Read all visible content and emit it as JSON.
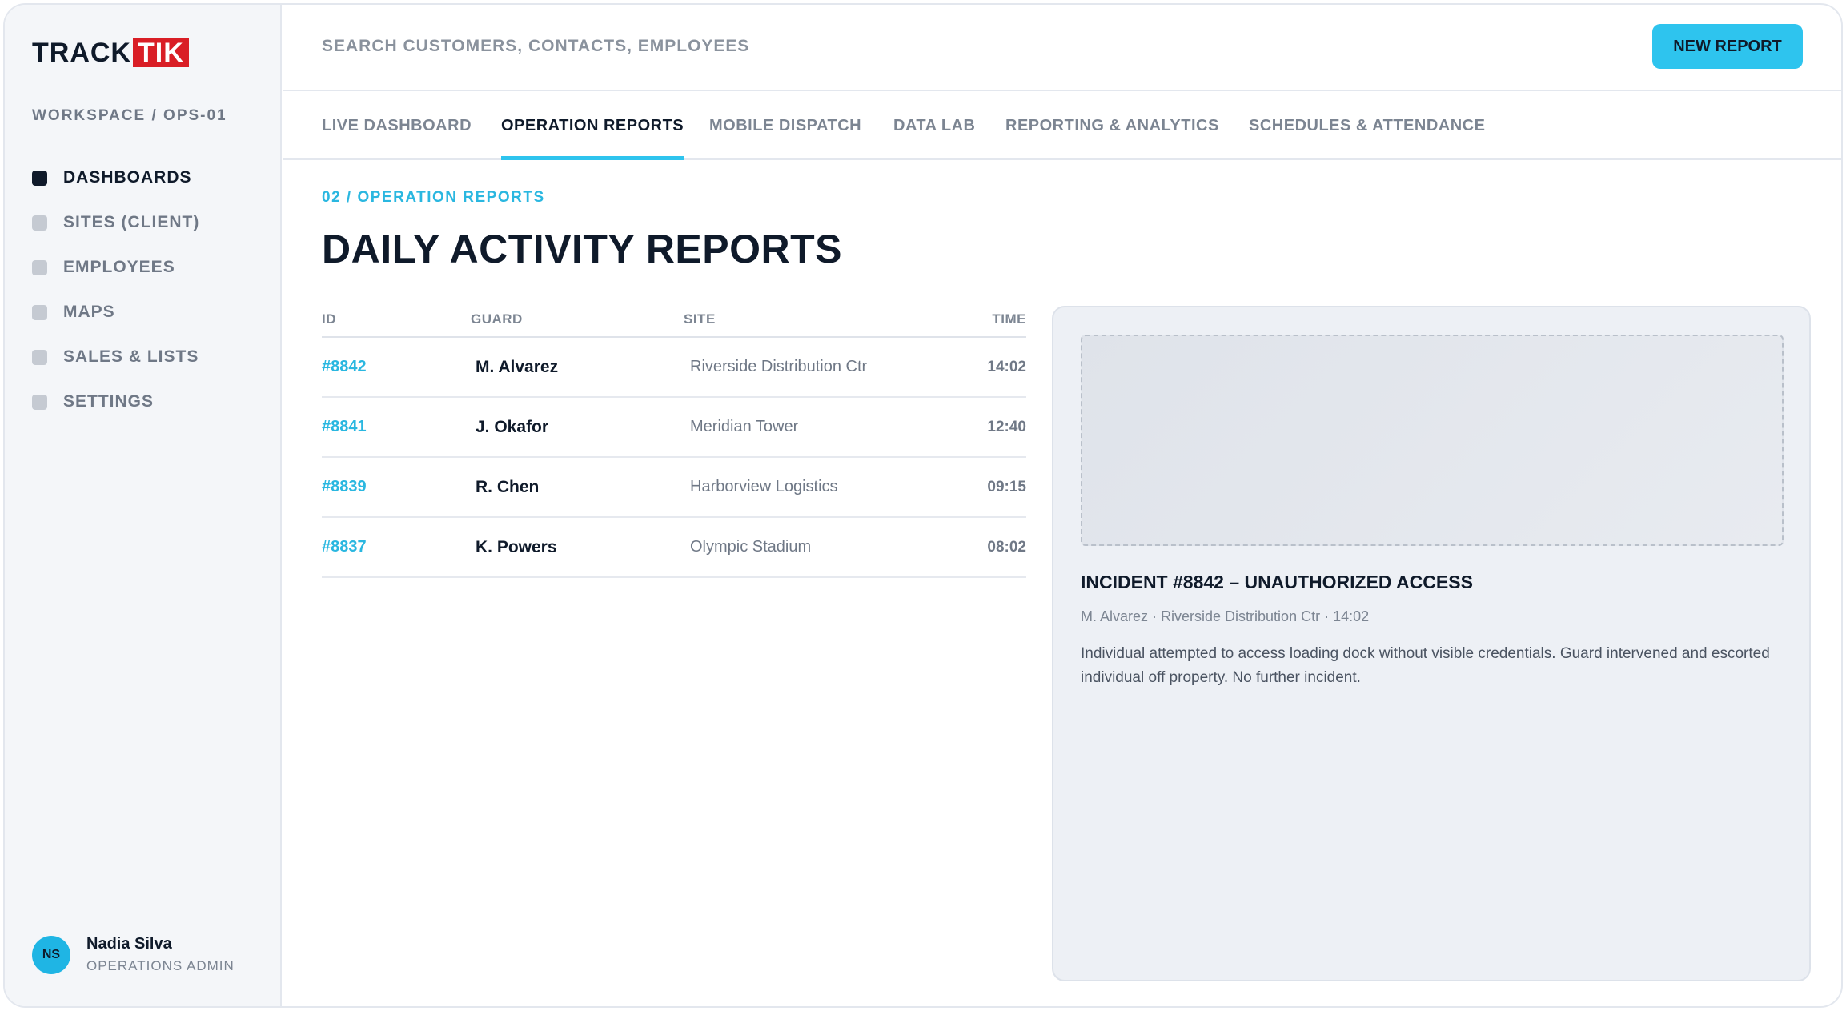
{
  "brand": {
    "track": "TRACK",
    "tik": "TIK"
  },
  "workspace": "WORKSPACE / OPS-01",
  "sidebar": {
    "items": [
      {
        "label": "DASHBOARDS"
      },
      {
        "label": "SITES (CLIENT)"
      },
      {
        "label": "EMPLOYEES"
      },
      {
        "label": "MAPS"
      },
      {
        "label": "SALES & LISTS"
      },
      {
        "label": "SETTINGS"
      }
    ],
    "active_index": 0
  },
  "user": {
    "initials": "NS",
    "name": "Nadia Silva",
    "role": "OPERATIONS ADMIN"
  },
  "topbar": {
    "search_placeholder": "SEARCH CUSTOMERS, CONTACTS, EMPLOYEES",
    "new_report_label": "NEW REPORT"
  },
  "tabs": [
    {
      "label": "LIVE DASHBOARD"
    },
    {
      "label": "OPERATION REPORTS"
    },
    {
      "label": "MOBILE DISPATCH"
    },
    {
      "label": "DATA LAB"
    },
    {
      "label": "REPORTING & ANALYTICS"
    },
    {
      "label": "SCHEDULES & ATTENDANCE"
    }
  ],
  "active_tab_index": 1,
  "main": {
    "breadcrumb": "02 / OPERATION REPORTS",
    "title": "DAILY ACTIVITY REPORTS",
    "columns": {
      "id": "ID",
      "guard": "GUARD",
      "site": "SITE",
      "time": "TIME"
    },
    "rows": [
      {
        "id": "#8842",
        "guard": "M. Alvarez",
        "site": "Riverside Distribution Ctr",
        "time": "14:02"
      },
      {
        "id": "#8841",
        "guard": "J. Okafor",
        "site": "Meridian Tower",
        "time": "12:40"
      },
      {
        "id": "#8839",
        "guard": "R. Chen",
        "site": "Harborview Logistics",
        "time": "09:15"
      },
      {
        "id": "#8837",
        "guard": "K. Powers",
        "site": "Olympic Stadium",
        "time": "08:02"
      }
    ]
  },
  "detail": {
    "title": "INCIDENT #8842 – UNAUTHORIZED ACCESS",
    "meta": "M. Alvarez · Riverside Distribution Ctr · 14:02",
    "description": "Individual attempted to access loading dock without visible credentials. Guard intervened and escorted individual off property. No further incident."
  },
  "colors": {
    "accent": "#2ec4ee",
    "brand_red": "#d91e26",
    "ink": "#0f1a2a",
    "muted": "#7c8592"
  }
}
